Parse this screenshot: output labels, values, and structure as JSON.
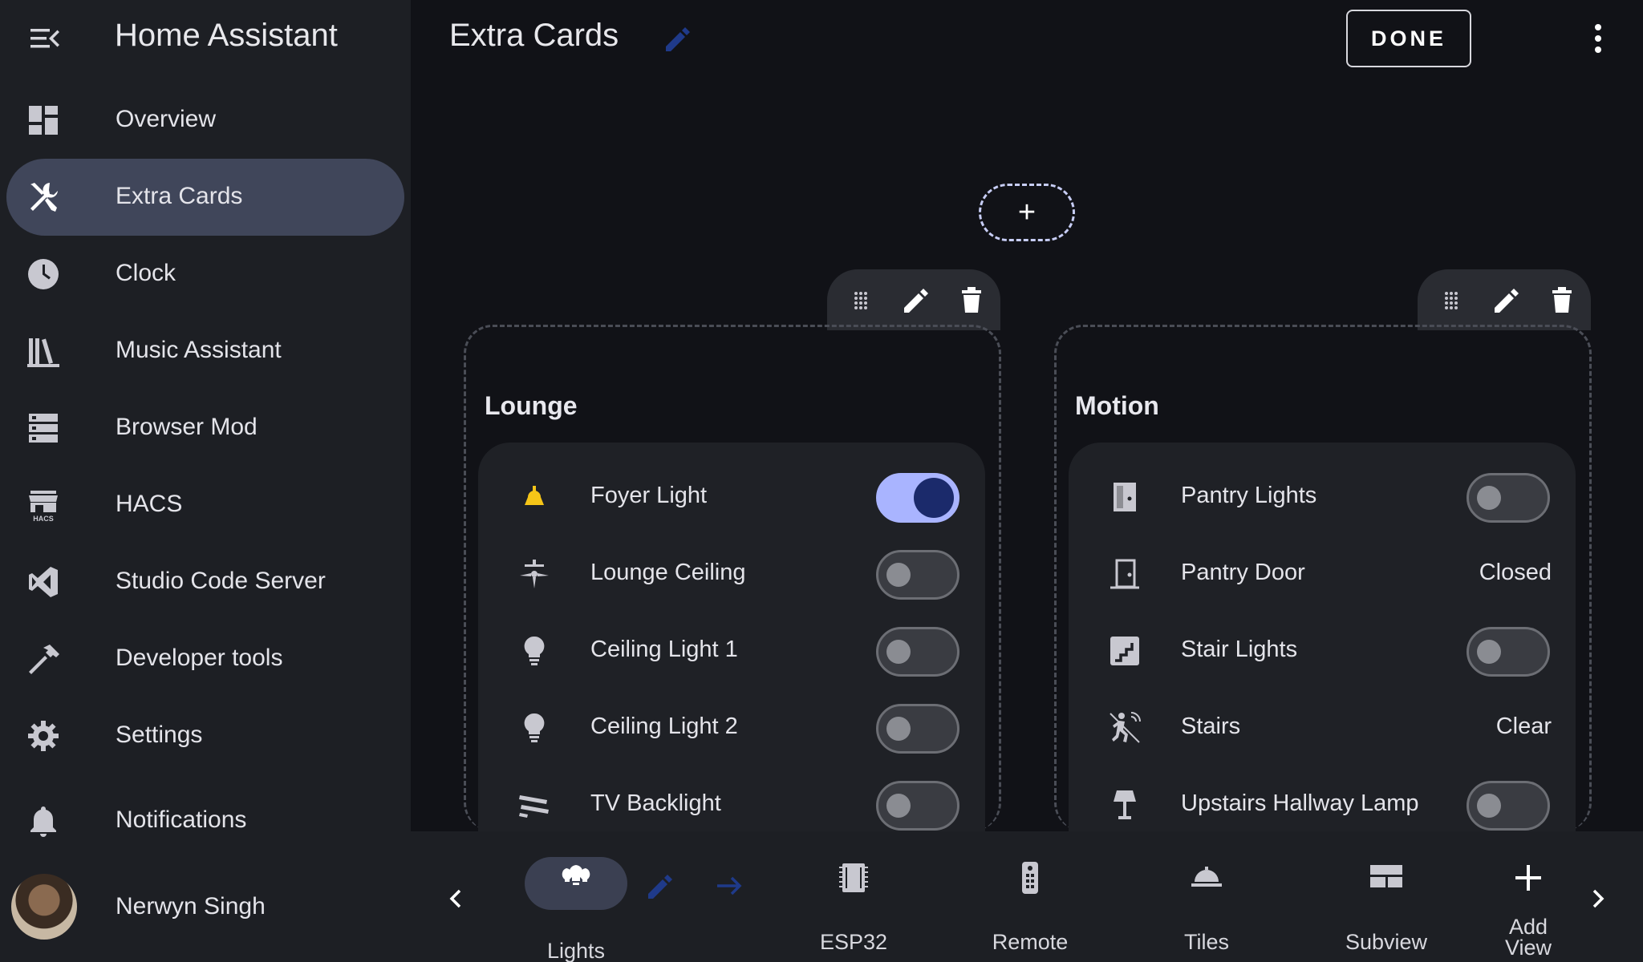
{
  "app_title": "Home Assistant",
  "sidebar": {
    "items": [
      {
        "label": "Overview",
        "icon": "dashboard-icon"
      },
      {
        "label": "Extra Cards",
        "icon": "tools-icon",
        "active": true
      },
      {
        "label": "Clock",
        "icon": "clock-icon"
      },
      {
        "label": "Music Assistant",
        "icon": "library-icon"
      },
      {
        "label": "Browser Mod",
        "icon": "server-icon"
      },
      {
        "label": "HACS",
        "icon": "hacs-icon"
      },
      {
        "label": "Studio Code Server",
        "icon": "vscode-icon"
      },
      {
        "label": "Developer tools",
        "icon": "hammer-icon"
      },
      {
        "label": "Settings",
        "icon": "gear-icon"
      }
    ],
    "notifications_label": "Notifications",
    "user_name": "Nerwyn Singh"
  },
  "header": {
    "title": "Extra Cards",
    "done_label": "DONE"
  },
  "add_section_label": "+",
  "cards": {
    "lounge": {
      "title": "Lounge",
      "rows": [
        {
          "label": "Foyer Light",
          "icon": "ceiling-light-icon",
          "toggle": true
        },
        {
          "label": "Lounge Ceiling",
          "icon": "ceiling-fan-icon",
          "toggle": false
        },
        {
          "label": "Ceiling Light 1",
          "icon": "lightbulb-icon",
          "toggle": false
        },
        {
          "label": "Ceiling Light 2",
          "icon": "lightbulb-icon",
          "toggle": false
        },
        {
          "label": "TV Backlight",
          "icon": "led-strip-icon",
          "toggle": false
        }
      ]
    },
    "motion": {
      "title": "Motion",
      "rows": [
        {
          "label": "Pantry Lights",
          "icon": "door-light-icon",
          "toggle": false
        },
        {
          "label": "Pantry Door",
          "icon": "door-icon",
          "state": "Closed"
        },
        {
          "label": "Stair Lights",
          "icon": "stairs-icon",
          "toggle": false
        },
        {
          "label": "Stairs",
          "icon": "motion-sensor-icon",
          "state": "Clear"
        },
        {
          "label": "Upstairs Hallway Lamp",
          "icon": "lamp-icon",
          "toggle": false
        }
      ]
    }
  },
  "views": [
    {
      "label": "Lights",
      "icon": "lightbulb-group-icon",
      "active": true
    },
    {
      "label": "ESP32",
      "icon": "chip-icon"
    },
    {
      "label": "Remote",
      "icon": "remote-icon"
    },
    {
      "label": "Tiles",
      "icon": "room-service-icon"
    },
    {
      "label": "Subview",
      "icon": "view-dashboard-icon"
    },
    {
      "label": "Add View",
      "line1": "Add",
      "line2": "View",
      "icon": "plus-icon"
    }
  ],
  "colors": {
    "accent": "#a9b4ff",
    "toggle_on_knob": "#1b2a6b",
    "active_nav": "#40465a",
    "foyer_light_icon": "#f5c518",
    "pencil_blue": "#1f3a8a"
  }
}
